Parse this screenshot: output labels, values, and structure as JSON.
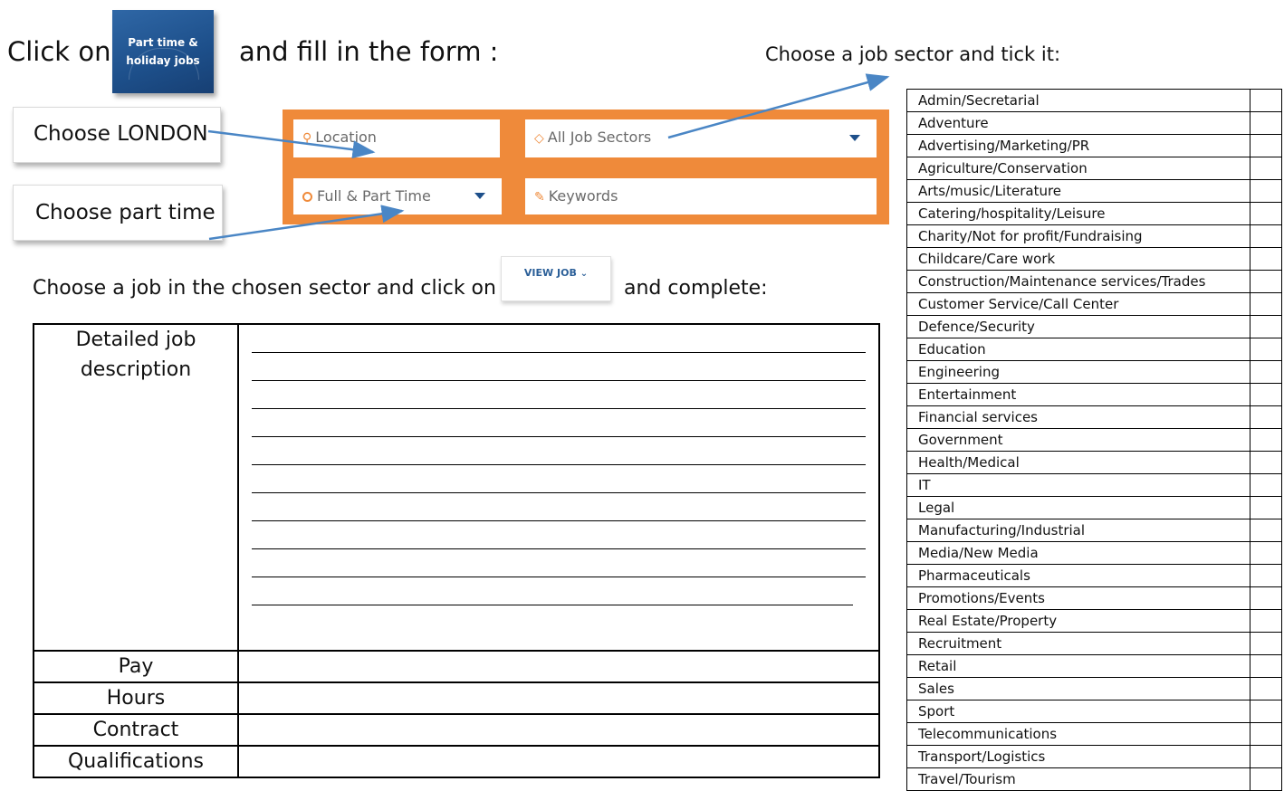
{
  "header": {
    "click_on": "Click on",
    "badge_line1": "Part time &",
    "badge_line2": "holiday jobs",
    "fill_in": "and fill in the form :",
    "sector_title": "Choose a job sector and tick it:"
  },
  "instructions": {
    "london": "Choose LONDON",
    "part_time": "Choose part time",
    "choose_job": "Choose a job in the chosen sector and click on",
    "and_complete": "and complete:"
  },
  "search_form": {
    "location": "Location",
    "sectors": "All Job Sectors",
    "time": "Full & Part Time",
    "keywords": "Keywords"
  },
  "view_job": {
    "label": "VIEW JOB"
  },
  "answer_table": {
    "rows": [
      {
        "label": "Detailed job description"
      },
      {
        "label": "Pay"
      },
      {
        "label": "Hours"
      },
      {
        "label": "Contract"
      },
      {
        "label": "Qualifications"
      }
    ]
  },
  "sectors": [
    "Admin/Secretarial",
    "Adventure",
    "Advertising/Marketing/PR",
    "Agriculture/Conservation",
    "Arts/music/Literature",
    "Catering/hospitality/Leisure",
    "Charity/Not for profit/Fundraising",
    "Childcare/Care work",
    "Construction/Maintenance services/Trades",
    "Customer Service/Call Center",
    "Defence/Security",
    "Education",
    "Engineering",
    "Entertainment",
    "Financial services",
    "Government",
    "Health/Medical",
    "IT",
    "Legal",
    "Manufacturing/Industrial",
    "Media/New Media",
    "Pharmaceuticals",
    "Promotions/Events",
    "Real Estate/Property",
    "Recruitment",
    "Retail",
    "Sales",
    "Sport",
    "Telecommunications",
    "Transport/Logistics",
    "Travel/Tourism"
  ],
  "colors": {
    "form_orange": "#ef8a3a",
    "badge_blue": "#1d4f8a",
    "arrow_blue": "#4a86c5"
  }
}
